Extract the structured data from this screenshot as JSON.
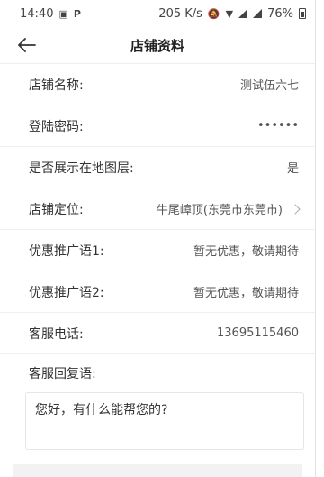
{
  "status": {
    "time": "14:40",
    "left_icons": [
      "image-icon",
      "p-icon"
    ],
    "speed": "205 K/s",
    "battery": "76%"
  },
  "header": {
    "title": "店铺资料"
  },
  "rows": [
    {
      "label": "店铺名称:",
      "value": "测试伍六七"
    },
    {
      "label": "登陆密码:",
      "value": "••••••"
    },
    {
      "label": "是否展示在地图层:",
      "value": "是"
    },
    {
      "label": "店铺定位:",
      "value": "牛尾嶂顶(东莞市东莞市)"
    },
    {
      "label": "优惠推广语1:",
      "value": "暂无优惠，敬请期待"
    },
    {
      "label": "优惠推广语2:",
      "value": "暂无优惠，敬请期待"
    },
    {
      "label": "客服电话:",
      "value": "13695115460"
    }
  ],
  "reply": {
    "label": "客服回复语:",
    "text": "您好，有什么能帮您的?"
  }
}
